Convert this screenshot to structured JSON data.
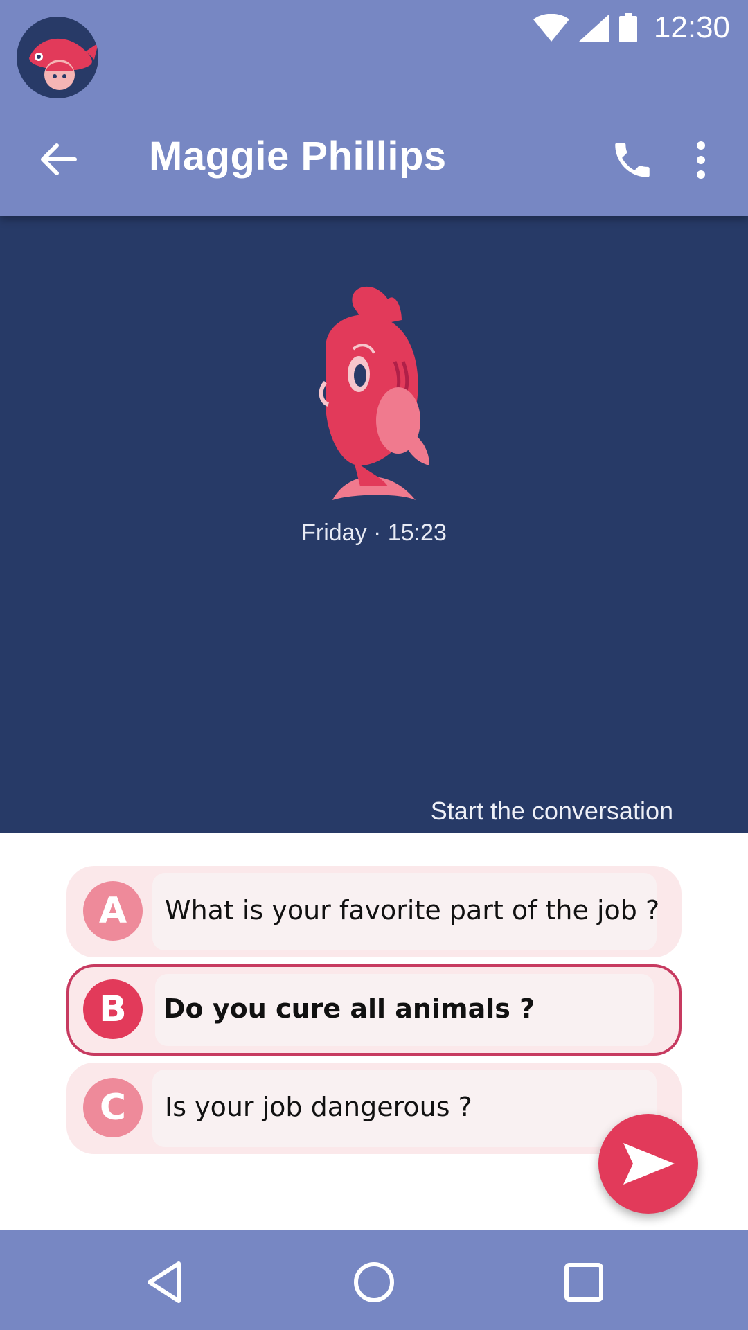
{
  "status_bar": {
    "time": "12:30",
    "icons": [
      "wifi-icon",
      "signal-icon",
      "battery-icon"
    ]
  },
  "header": {
    "title": "Maggie Phillips",
    "actions": [
      "back-arrow-icon",
      "phone-icon",
      "more-vert-icon"
    ]
  },
  "conversation": {
    "timestamp": "Friday · 15:23",
    "start_label": "Start the conversation"
  },
  "choices": [
    {
      "letter": "A",
      "text": "What is your favorite part of the job ?",
      "selected": false
    },
    {
      "letter": "B",
      "text": "Do you cure all animals ?",
      "selected": true
    },
    {
      "letter": "C",
      "text": "Is your job dangerous ?",
      "selected": false
    }
  ],
  "colors": {
    "header_bg": "#7787c3",
    "conversation_bg": "#273a67",
    "accent": "#e23a5a",
    "choice_bg": "#fbe8ea"
  },
  "nav": {
    "icons": [
      "nav-back-icon",
      "nav-home-icon",
      "nav-recents-icon"
    ]
  }
}
